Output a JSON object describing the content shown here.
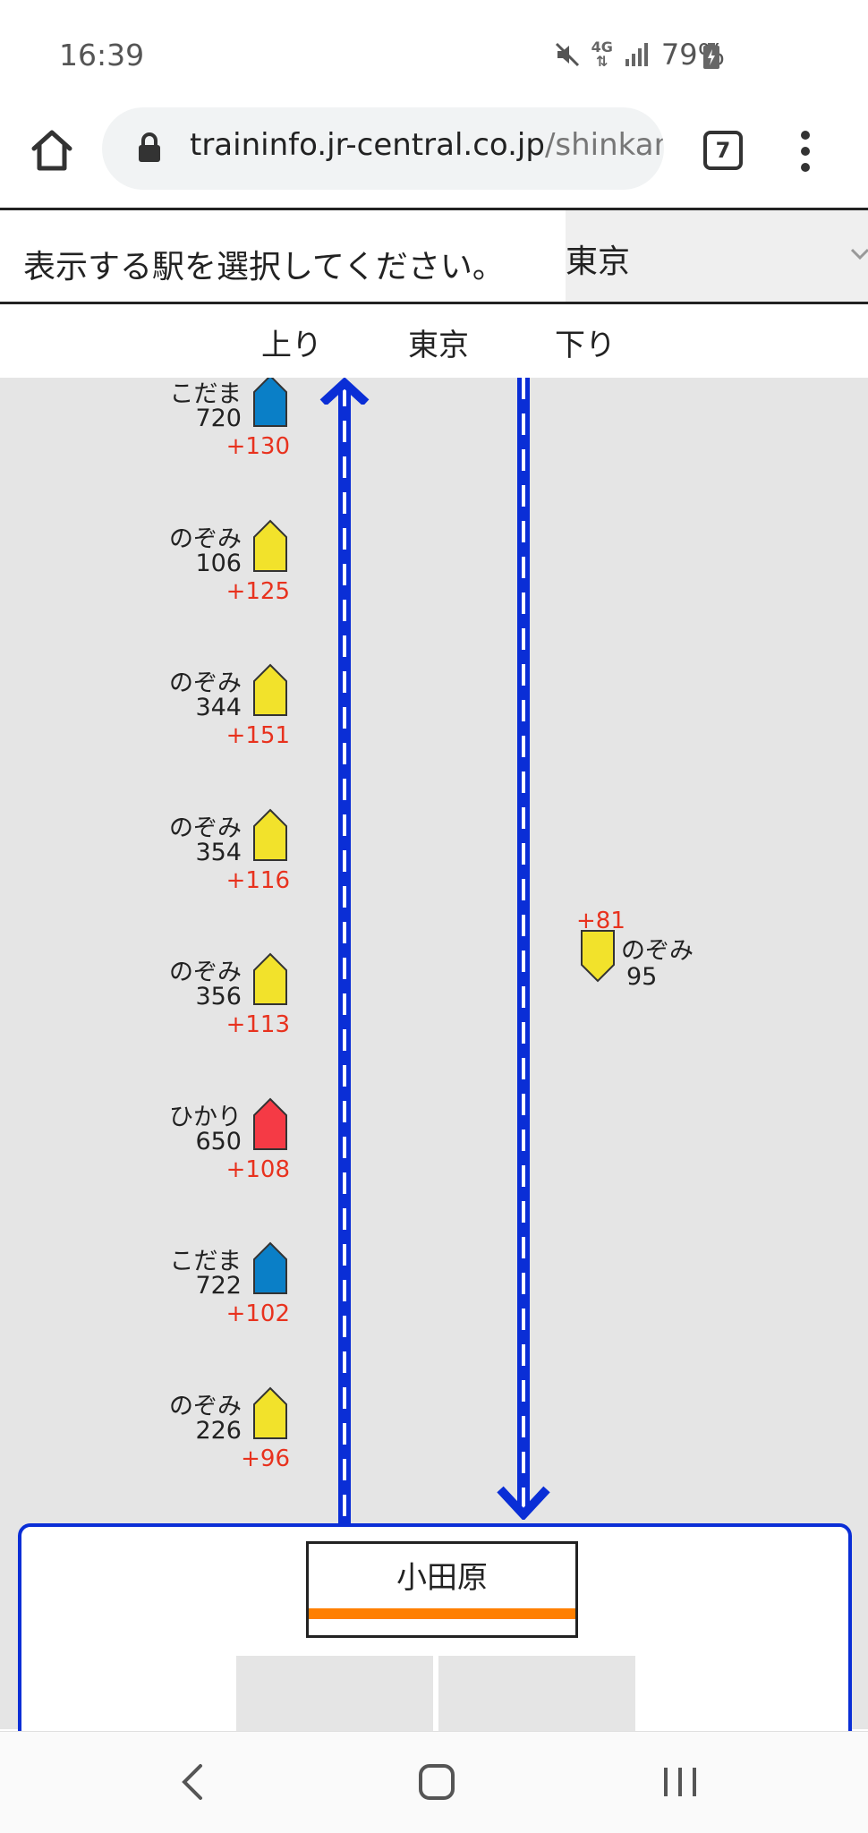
{
  "status_bar": {
    "time": "16:39",
    "network": "4G",
    "battery": "79%",
    "icons": [
      "mute-icon",
      "network-4g-icon",
      "signal-icon",
      "battery-charging-icon"
    ]
  },
  "browser": {
    "url_domain": "traininfo.jr-central.co.jp",
    "url_path": "/shinkanse",
    "tab_count": "7",
    "icons": [
      "home-icon",
      "lock-icon",
      "tabs-icon",
      "more-vert-icon"
    ]
  },
  "station_select": {
    "prompt": "表示する駅を選択してください。",
    "value": "東京"
  },
  "direction_header": {
    "up": "上り",
    "station": "東京",
    "down": "下り"
  },
  "trains_up": [
    {
      "name": "こだま",
      "number": "720",
      "delay": "+130",
      "type": "kodama",
      "color": "#0a7fc7"
    },
    {
      "name": "のぞみ",
      "number": "106",
      "delay": "+125",
      "type": "nozomi",
      "color": "#f2e22b"
    },
    {
      "name": "のぞみ",
      "number": "344",
      "delay": "+151",
      "type": "nozomi",
      "color": "#f2e22b"
    },
    {
      "name": "のぞみ",
      "number": "354",
      "delay": "+116",
      "type": "nozomi",
      "color": "#f2e22b"
    },
    {
      "name": "のぞみ",
      "number": "356",
      "delay": "+113",
      "type": "nozomi",
      "color": "#f2e22b"
    },
    {
      "name": "ひかり",
      "number": "650",
      "delay": "+108",
      "type": "hikari",
      "color": "#f53a45"
    },
    {
      "name": "こだま",
      "number": "722",
      "delay": "+102",
      "type": "kodama",
      "color": "#0a7fc7"
    },
    {
      "name": "のぞみ",
      "number": "226",
      "delay": "+96",
      "type": "nozomi",
      "color": "#f2e22b"
    }
  ],
  "trains_down": [
    {
      "name": "のぞみ",
      "number": "95",
      "delay": "+81",
      "type": "nozomi",
      "color": "#f2e22b"
    }
  ],
  "station_card": {
    "name": "小田原",
    "line_color": "#ff7f00"
  },
  "colors": {
    "track": "#0a2ed6",
    "delay_text": "#e8321e",
    "track_background": "#e5e5e5"
  }
}
